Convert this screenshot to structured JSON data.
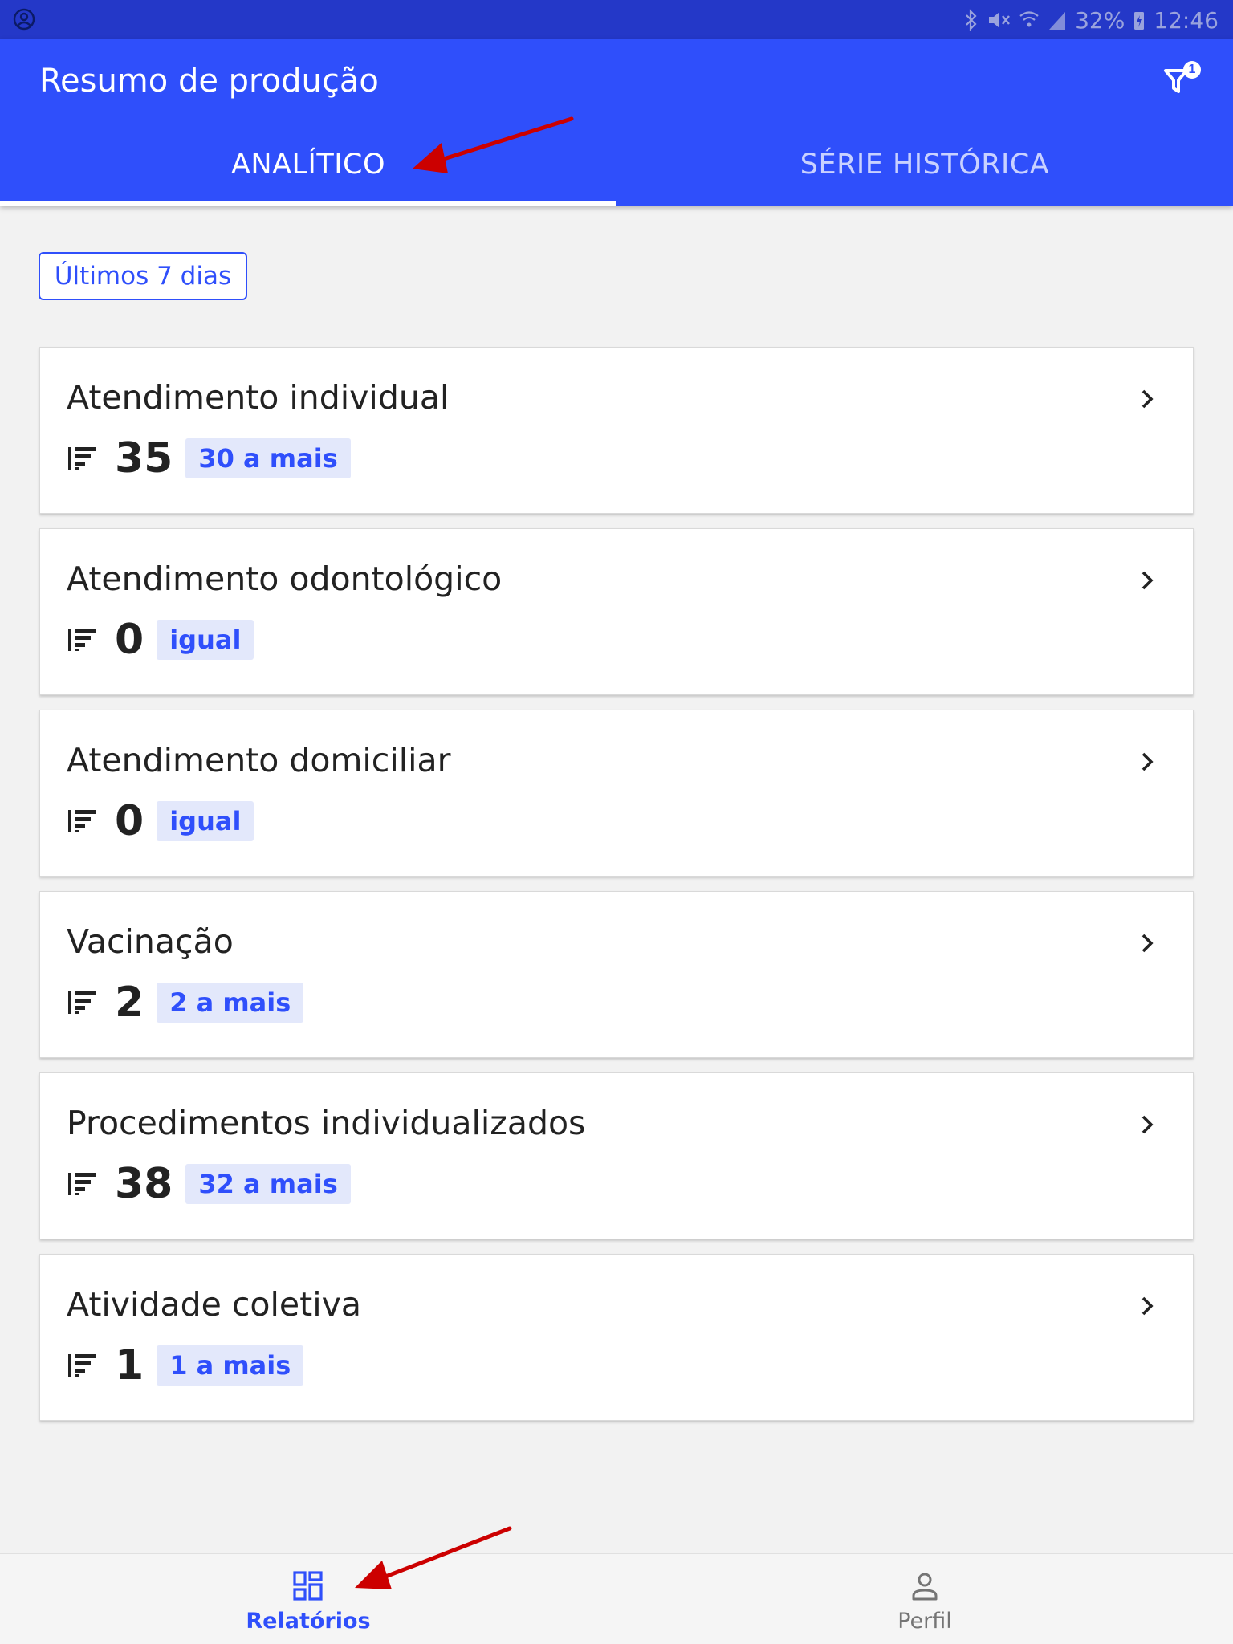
{
  "status_bar": {
    "battery": "32%",
    "time": "12:46"
  },
  "header": {
    "title": "Resumo de produção",
    "filter_count": "1"
  },
  "tabs": [
    {
      "label": "ANALÍTICO",
      "active": true
    },
    {
      "label": "SÉRIE HISTÓRICA",
      "active": false
    }
  ],
  "period": {
    "label": "Últimos 7 dias"
  },
  "cards": [
    {
      "title": "Atendimento individual",
      "value": "35",
      "badge": "30 a mais"
    },
    {
      "title": "Atendimento odontológico",
      "value": "0",
      "badge": "igual"
    },
    {
      "title": "Atendimento domiciliar",
      "value": "0",
      "badge": "igual"
    },
    {
      "title": "Vacinação",
      "value": "2",
      "badge": "2 a mais"
    },
    {
      "title": "Procedimentos individualizados",
      "value": "38",
      "badge": "32 a mais"
    },
    {
      "title": "Atividade coletiva",
      "value": "1",
      "badge": "1 a mais"
    }
  ],
  "bottom_nav": [
    {
      "label": "Relatórios",
      "icon": "dashboard-icon",
      "active": true
    },
    {
      "label": "Perfil",
      "icon": "person-icon",
      "active": false
    }
  ],
  "colors": {
    "primary": "#2f4ffb",
    "status_bar": "#2438c8",
    "badge_bg": "#e3e8fb",
    "annotation_arrow": "#cc0000"
  }
}
